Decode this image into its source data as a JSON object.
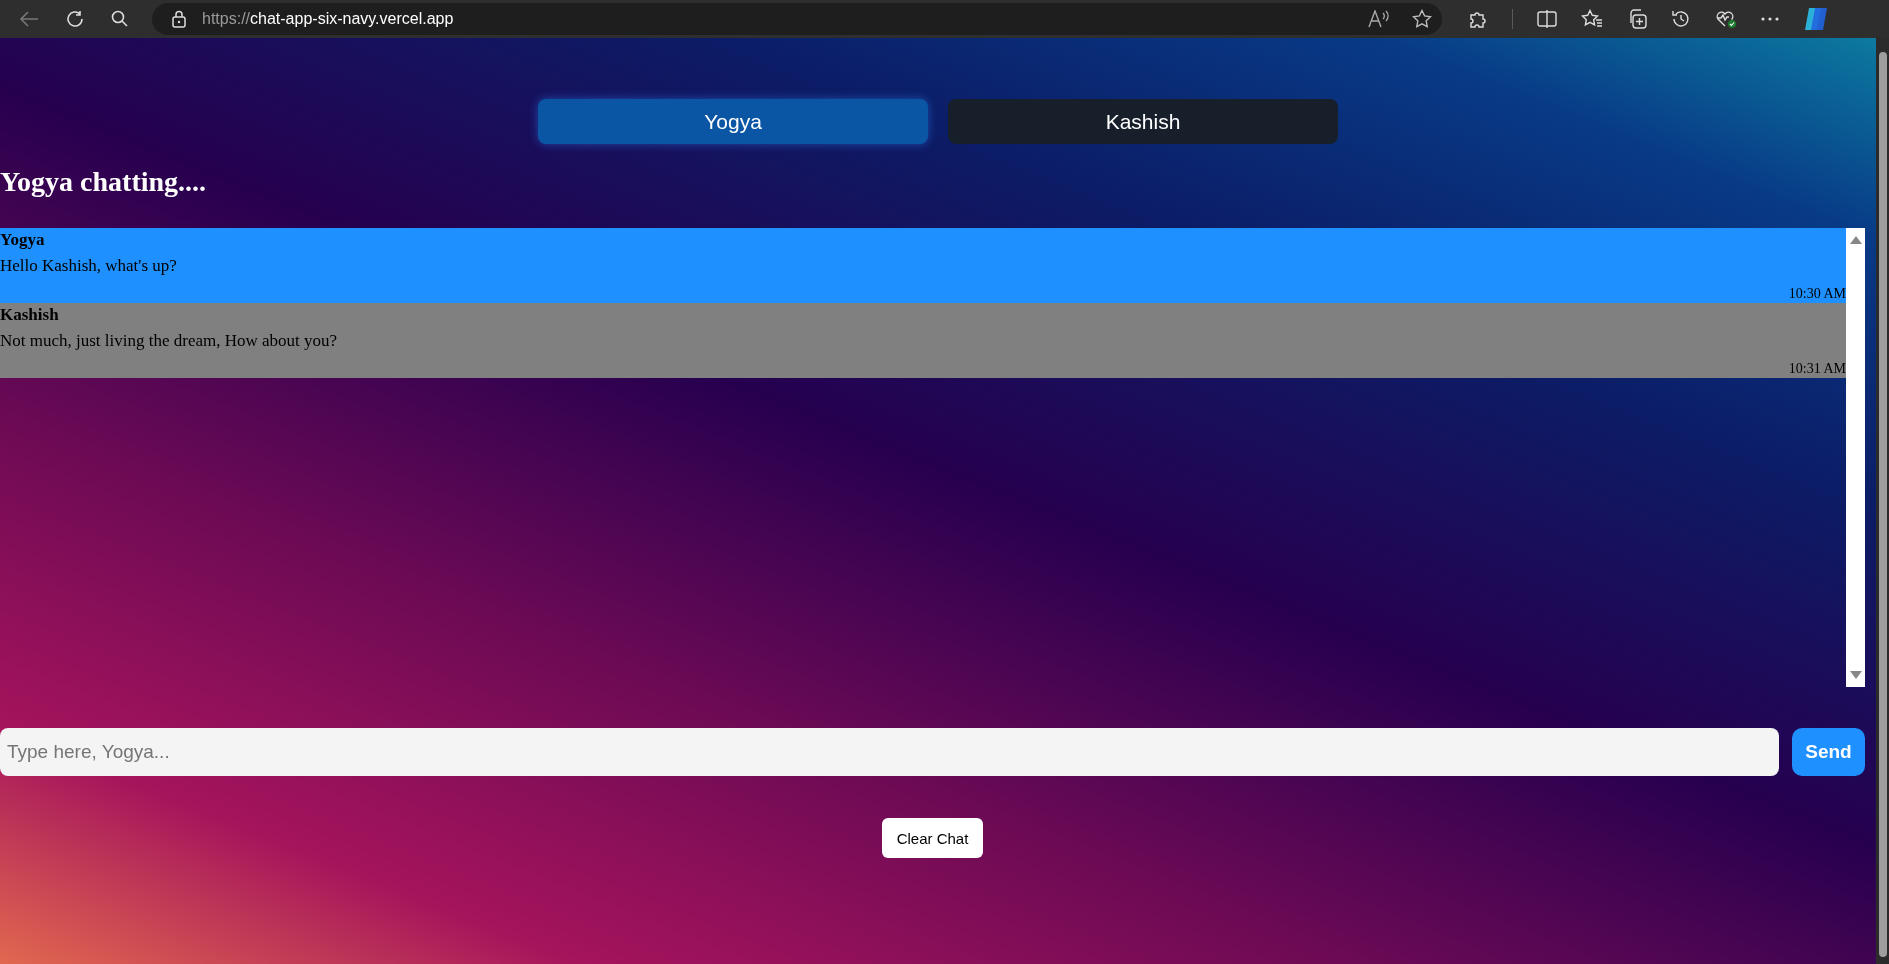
{
  "browser": {
    "url_scheme": "https://",
    "url_host": "chat-app-six-navy.vercel.app"
  },
  "tabs": [
    {
      "label": "Yogya",
      "selected": true
    },
    {
      "label": "Kashish",
      "selected": false
    }
  ],
  "heading": "Yogya chatting....",
  "messages": [
    {
      "sender": "Yogya",
      "text": "Hello Kashish, what's up?",
      "time": "10:30 AM",
      "color": "#1e90ff"
    },
    {
      "sender": "Kashish",
      "text": "Not much, just living the dream, How about you?",
      "time": "10:31 AM",
      "color": "#808080"
    }
  ],
  "composer": {
    "placeholder": "Type here, Yogya...",
    "send": "Send"
  },
  "clear_button": "Clear Chat"
}
